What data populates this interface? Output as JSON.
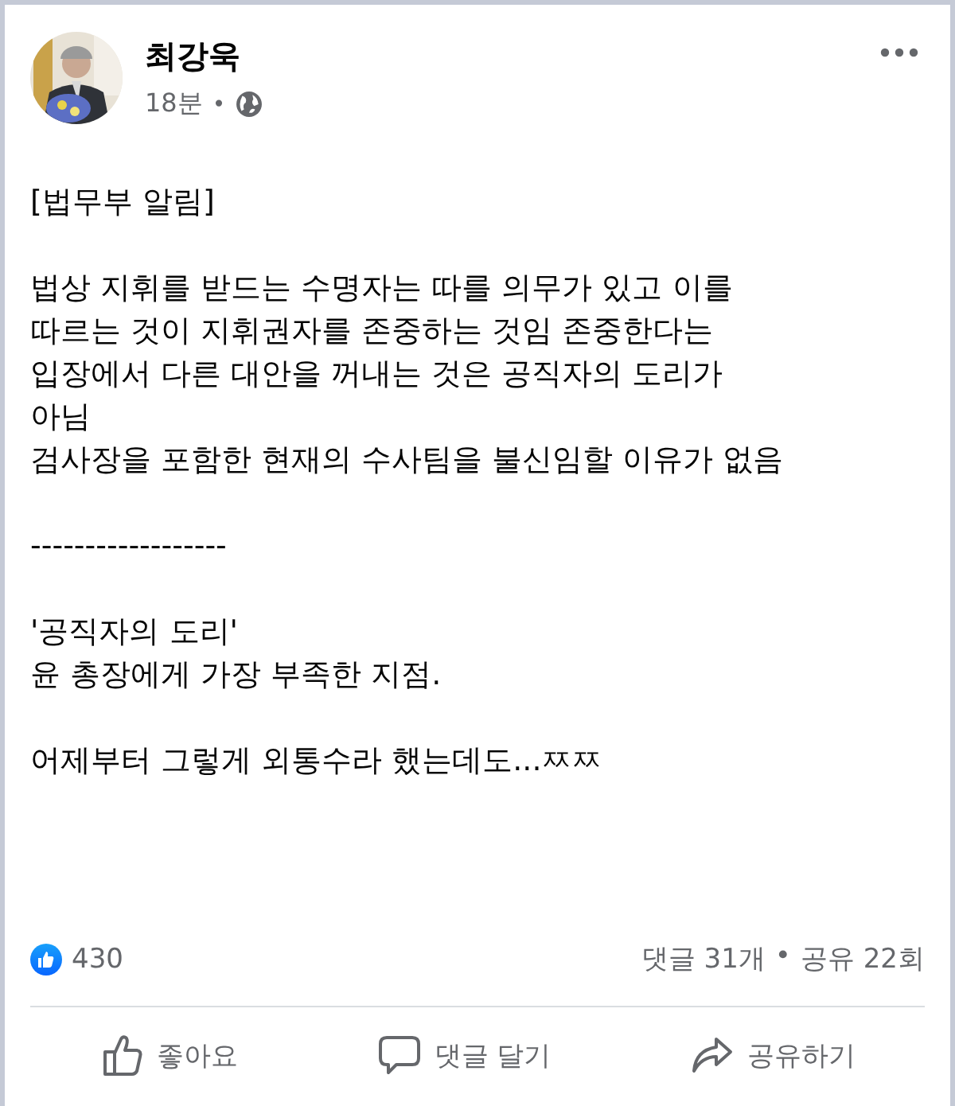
{
  "post": {
    "author": "최강욱",
    "time": "18분",
    "separator": "•",
    "paragraphs": [
      [
        "[법무부 알림]"
      ],
      [
        "법상 지휘를 받드는 수명자는 따를 의무가 있고 이를",
        "따르는 것이 지휘권자를 존중하는 것임 존중한다는",
        "입장에서 다른 대안을 꺼내는 것은 공직자의 도리가",
        "아님",
        "검사장을 포함한 현재의 수사팀을 불신임할 이유가 없음"
      ],
      [
        "------------------"
      ],
      [
        "'공직자의 도리'",
        "윤 총장에게 가장 부족한 지점."
      ],
      [
        "어제부터 그렇게 외통수라 했는데도...ㅉㅉ"
      ]
    ],
    "likes": "430",
    "comments": "댓글 31개",
    "stats_separator": "•",
    "shares": "공유 22회",
    "actions": [
      {
        "kind": "like",
        "label": "좋아요"
      },
      {
        "kind": "comment",
        "label": "댓글 달기"
      },
      {
        "kind": "share",
        "label": "공유하기"
      }
    ]
  }
}
